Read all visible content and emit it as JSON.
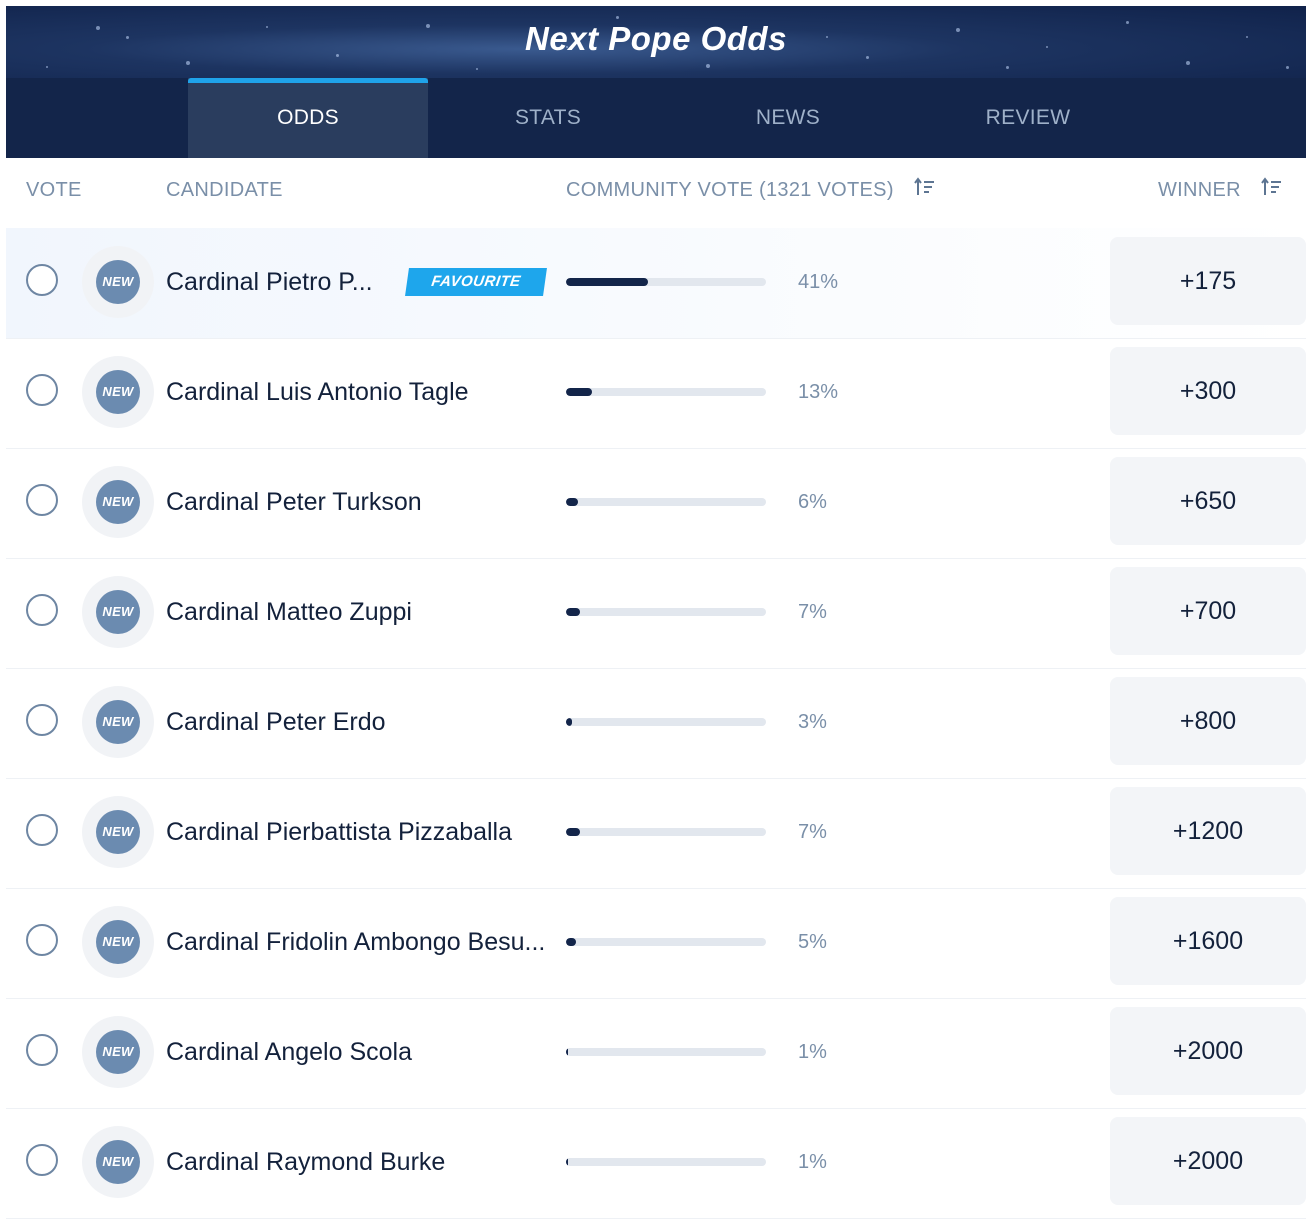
{
  "header": {
    "title": "Next Pope Odds",
    "tabs": [
      {
        "label": "ODDS",
        "active": true
      },
      {
        "label": "STATS",
        "active": false
      },
      {
        "label": "NEWS",
        "active": false
      },
      {
        "label": "REVIEW",
        "active": false
      }
    ]
  },
  "columns": {
    "vote": "VOTE",
    "candidate": "CANDIDATE",
    "community": "COMMUNITY VOTE (1321 VOTES)",
    "winner": "WINNER"
  },
  "colors": {
    "navy": "#13254a",
    "accent_blue": "#1ea6ec",
    "muted_text": "#7a8fa8"
  },
  "avatar_label": "NEW",
  "favourite_label": "FAVOURITE",
  "candidates": [
    {
      "name": "Cardinal Pietro P...",
      "favourite": true,
      "vote_pct": 41,
      "vote_label": "41%",
      "odds": "+175"
    },
    {
      "name": "Cardinal Luis Antonio Tagle",
      "favourite": false,
      "vote_pct": 13,
      "vote_label": "13%",
      "odds": "+300"
    },
    {
      "name": "Cardinal Peter Turkson",
      "favourite": false,
      "vote_pct": 6,
      "vote_label": "6%",
      "odds": "+650"
    },
    {
      "name": "Cardinal Matteo Zuppi",
      "favourite": false,
      "vote_pct": 7,
      "vote_label": "7%",
      "odds": "+700"
    },
    {
      "name": "Cardinal Peter Erdo",
      "favourite": false,
      "vote_pct": 3,
      "vote_label": "3%",
      "odds": "+800"
    },
    {
      "name": "Cardinal Pierbattista Pizzaballa",
      "favourite": false,
      "vote_pct": 7,
      "vote_label": "7%",
      "odds": "+1200"
    },
    {
      "name": "Cardinal Fridolin Ambongo Besu...",
      "favourite": false,
      "vote_pct": 5,
      "vote_label": "5%",
      "odds": "+1600"
    },
    {
      "name": "Cardinal Angelo Scola",
      "favourite": false,
      "vote_pct": 1,
      "vote_label": "1%",
      "odds": "+2000"
    },
    {
      "name": "Cardinal Raymond Burke",
      "favourite": false,
      "vote_pct": 1,
      "vote_label": "1%",
      "odds": "+2000"
    }
  ]
}
